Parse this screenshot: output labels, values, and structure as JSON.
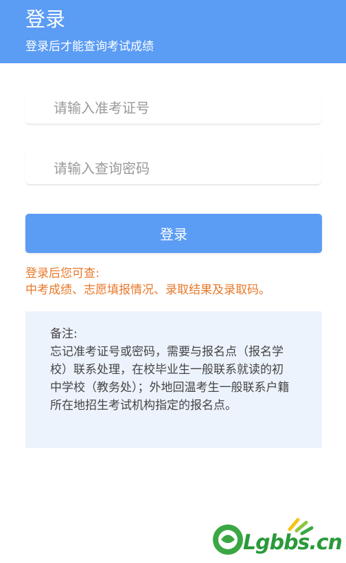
{
  "header": {
    "title": "登录",
    "subtitle": "登录后才能查询考试成绩"
  },
  "form": {
    "exam_id_placeholder": "请输入准考证号",
    "password_placeholder": "请输入查询密码",
    "login_label": "登录"
  },
  "hint": {
    "line1": "登录后您可查:",
    "line2": "中考成绩、志愿填报情况、录取结果及录取码。"
  },
  "note": {
    "title": "备注:",
    "text": "忘记准考证号或密码，需要与报名点（报名学校）联系处理，在校毕业生一般联系就读的初中学校（教务处）；外地回温考生一般联系户籍所在地招生考试机构指定的报名点。"
  },
  "watermark": {
    "text": "Lgbbs.cn"
  },
  "colors": {
    "primary": "#5b9cf4",
    "hint": "#e8782a",
    "note_bg": "#edf3fd"
  }
}
